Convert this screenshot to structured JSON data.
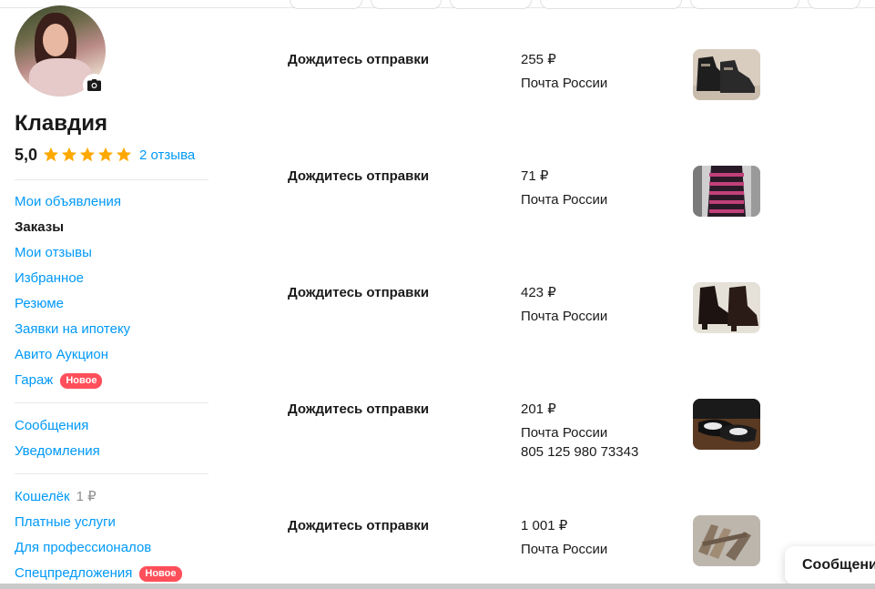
{
  "profile": {
    "name": "Клавдия",
    "rating": "5,0",
    "stars": 5,
    "reviews_link": "2 отзыва",
    "camera_icon": "camera-icon"
  },
  "nav": {
    "group1": [
      {
        "label": "Мои объявления",
        "active": false
      },
      {
        "label": "Заказы",
        "active": true
      },
      {
        "label": "Мои отзывы",
        "active": false
      },
      {
        "label": "Избранное",
        "active": false
      },
      {
        "label": "Резюме",
        "active": false
      },
      {
        "label": "Заявки на ипотеку",
        "active": false
      },
      {
        "label": "Авито Аукцион",
        "active": false
      },
      {
        "label": "Гараж",
        "active": false,
        "badge": "Новое"
      }
    ],
    "group2": [
      {
        "label": "Сообщения"
      },
      {
        "label": "Уведомления"
      }
    ],
    "group3": [
      {
        "label": "Кошелёк",
        "amount": "1 ₽"
      },
      {
        "label": "Платные услуги"
      },
      {
        "label": "Для профессионалов"
      },
      {
        "label": "Спецпредложения",
        "badge": "Новое"
      }
    ]
  },
  "orders": [
    {
      "status": "Дождитесь отправки",
      "price": "255 ₽",
      "delivery": "Почта России",
      "track": "",
      "thumb": "boots-photo"
    },
    {
      "status": "Дождитесь отправки",
      "price": "71 ₽",
      "delivery": "Почта России",
      "track": "",
      "thumb": "striped-dress-photo"
    },
    {
      "status": "Дождитесь отправки",
      "price": "423 ₽",
      "delivery": "Почта России",
      "track": "",
      "thumb": "ankle-boots-photo"
    },
    {
      "status": "Дождитесь отправки",
      "price": "201 ₽",
      "delivery": "Почта России",
      "track": "805 125 980 73343",
      "thumb": "flats-photo"
    },
    {
      "status": "Дождитесь отправки",
      "price": "1 001 ₽",
      "delivery": "Почта России",
      "track": "",
      "thumb": "sandals-photo"
    }
  ],
  "messages_button": "Сообщения",
  "colors": {
    "link": "#0099f7",
    "star": "#ffa800",
    "badge": "#ff4f5a"
  }
}
